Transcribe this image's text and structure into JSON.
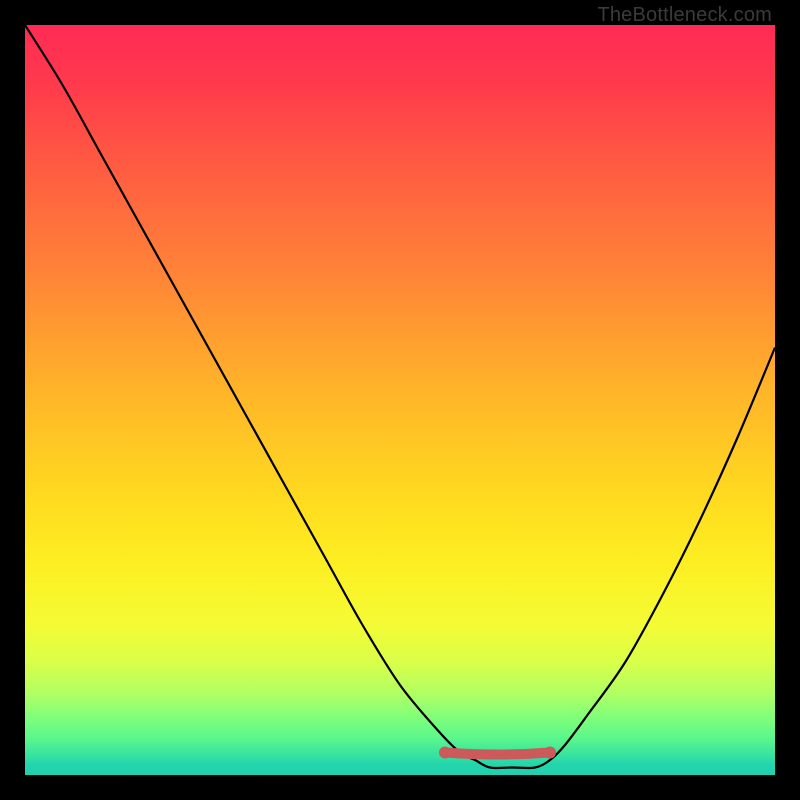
{
  "watermark": "TheBottleneck.com",
  "chart_data": {
    "type": "line",
    "title": "",
    "xlabel": "",
    "ylabel": "",
    "xlim": [
      0,
      100
    ],
    "ylim": [
      0,
      100
    ],
    "series": [
      {
        "name": "curve",
        "x": [
          0,
          5,
          10,
          15,
          20,
          25,
          30,
          35,
          40,
          45,
          50,
          55,
          58,
          60,
          62,
          65,
          68,
          70,
          72,
          75,
          80,
          85,
          90,
          95,
          100
        ],
        "y": [
          100,
          92,
          83,
          74,
          65,
          56,
          47,
          38,
          29,
          20,
          12,
          6,
          3,
          2,
          1,
          1,
          1,
          2,
          4,
          8,
          15,
          24,
          34,
          45,
          57
        ]
      }
    ],
    "highlight": {
      "name": "optimal-range",
      "x": [
        56,
        70
      ],
      "y": [
        3,
        3
      ]
    },
    "background_gradient": {
      "top": "#ff2a55",
      "mid": "#ffdd1f",
      "bottom": "#1fd0b0"
    }
  }
}
